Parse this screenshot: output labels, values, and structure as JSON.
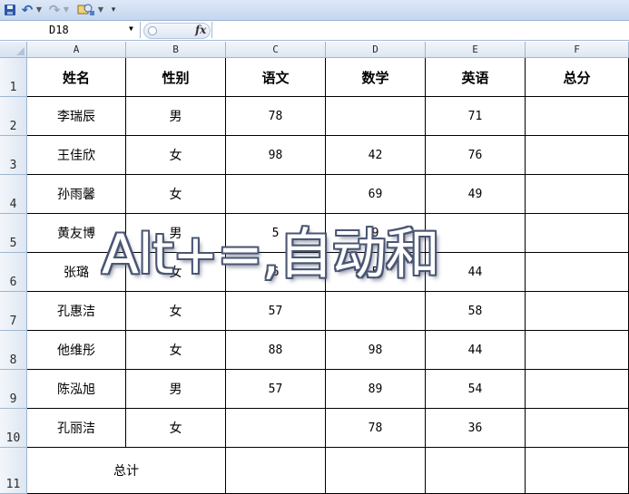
{
  "formula_bar": {
    "name_box": "D18",
    "fx_label": "fx",
    "formula": ""
  },
  "toolbar": {
    "icons": [
      "save-icon",
      "undo-icon",
      "redo-icon",
      "customize-icon",
      "more-icon"
    ]
  },
  "columns": [
    "A",
    "B",
    "C",
    "D",
    "E",
    "F"
  ],
  "rows": [
    "1",
    "2",
    "3",
    "4",
    "5",
    "6",
    "7",
    "8",
    "9",
    "10",
    "11"
  ],
  "table": {
    "header": [
      "姓名",
      "性别",
      "语文",
      "数学",
      "英语",
      "总分"
    ],
    "data": [
      [
        "李瑞辰",
        "男",
        "78",
        "",
        "71",
        ""
      ],
      [
        "王佳欣",
        "女",
        "98",
        "42",
        "76",
        ""
      ],
      [
        "孙雨馨",
        "女",
        "",
        "69",
        "49",
        ""
      ],
      [
        "黄友博",
        "男",
        "5",
        "9",
        "",
        ""
      ],
      [
        "张璐",
        "女",
        "6",
        "5",
        "44",
        ""
      ],
      [
        "孔惠洁",
        "女",
        "57",
        "",
        "58",
        ""
      ],
      [
        "他维彤",
        "女",
        "88",
        "98",
        "44",
        ""
      ],
      [
        "陈泓旭",
        "男",
        "57",
        "89",
        "54",
        ""
      ],
      [
        "孔丽洁",
        "女",
        "",
        "78",
        "36",
        ""
      ]
    ],
    "total_label": "总计"
  },
  "overlay_caption": "Alt+=,自动和",
  "colors": {
    "header_gradient_top": "#f3f6fb",
    "header_gradient_bottom": "#dde6f2",
    "toolbar_blue": "#c4d7f0",
    "grid_line": "#000000"
  }
}
